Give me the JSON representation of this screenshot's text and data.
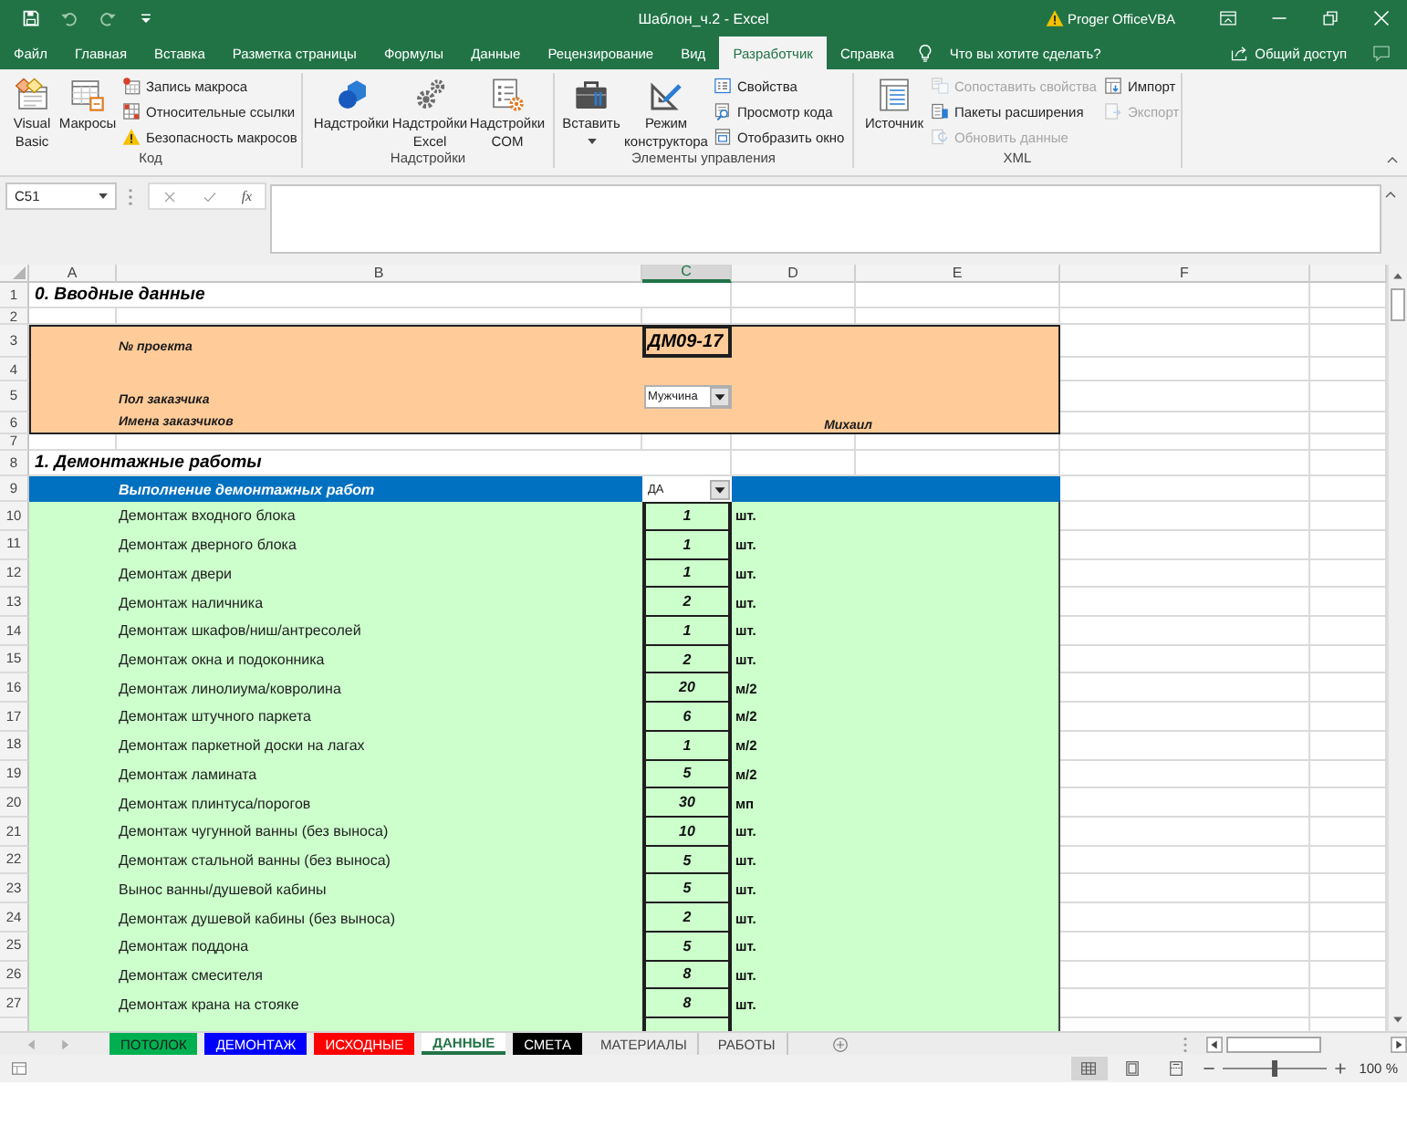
{
  "title_bar": {
    "title": "Шаблон_ч.2 - Excel",
    "account": "Proger OfficeVBA"
  },
  "ribbon_tabs": [
    {
      "label": "Файл",
      "selected": false
    },
    {
      "label": "Главная",
      "selected": false
    },
    {
      "label": "Вставка",
      "selected": false
    },
    {
      "label": "Разметка страницы",
      "selected": false
    },
    {
      "label": "Формулы",
      "selected": false
    },
    {
      "label": "Данные",
      "selected": false
    },
    {
      "label": "Рецензирование",
      "selected": false
    },
    {
      "label": "Вид",
      "selected": false
    },
    {
      "label": "Разработчик",
      "selected": true
    },
    {
      "label": "Справка",
      "selected": false
    }
  ],
  "tell_me": {
    "placeholder": "Что вы хотите сделать?"
  },
  "share": {
    "label": "Общий доступ"
  },
  "ribbon_groups": [
    {
      "label": "Код",
      "large_buttons": [
        {
          "label": "Visual Basic"
        },
        {
          "label": "Макросы"
        }
      ],
      "small_buttons": [
        {
          "label": "Запись макроса",
          "disabled": false
        },
        {
          "label": "Относительные ссылки",
          "disabled": false
        },
        {
          "label": "Безопасность макросов",
          "disabled": false
        }
      ]
    },
    {
      "label": "Надстройки",
      "large_buttons": [
        {
          "label": "Надстройки"
        },
        {
          "label": "Надстройки Excel"
        },
        {
          "label": "Надстройки COM"
        }
      ]
    },
    {
      "label": "Элементы управления",
      "large_buttons": [
        {
          "label": "Вставить"
        },
        {
          "label": "Режим конструктора"
        }
      ],
      "small_buttons": [
        {
          "label": "Свойства",
          "disabled": false
        },
        {
          "label": "Просмотр кода",
          "disabled": false
        },
        {
          "label": "Отобразить окно",
          "disabled": false
        }
      ]
    },
    {
      "label": "XML",
      "large_buttons": [
        {
          "label": "Источник"
        }
      ],
      "small_buttons": [
        {
          "label": "Сопоставить свойства",
          "disabled": true
        },
        {
          "label": "Пакеты расширения",
          "disabled": false
        },
        {
          "label": "Обновить данные",
          "disabled": true
        },
        {
          "label": "Импорт",
          "disabled": false
        },
        {
          "label": "Экспорт",
          "disabled": true
        }
      ]
    }
  ],
  "formula_bar": {
    "name_box": "C51",
    "function_button": "fx"
  },
  "columns": [
    {
      "label": "A",
      "selected": false
    },
    {
      "label": "B",
      "selected": false
    },
    {
      "label": "C",
      "selected": true
    },
    {
      "label": "D",
      "selected": false
    },
    {
      "label": "E",
      "selected": false
    },
    {
      "label": "F",
      "selected": false
    }
  ],
  "rows": [
    {
      "number": "1",
      "kind": "title",
      "text": "0. Вводные данные"
    },
    {
      "number": "2",
      "kind": "blank"
    },
    {
      "number": "3",
      "kind": "info",
      "label": "№ проекта",
      "value": "ДМ09-17"
    },
    {
      "number": "4",
      "kind": "info"
    },
    {
      "number": "5",
      "kind": "info",
      "label": "Пол заказчика",
      "dropdown": "Мужчина"
    },
    {
      "number": "6",
      "kind": "info",
      "label": "Имена заказчиков",
      "note": "Михаил"
    },
    {
      "number": "7",
      "kind": "blank"
    },
    {
      "number": "8",
      "kind": "title",
      "text": "1. Демонтажные работы"
    },
    {
      "number": "9",
      "kind": "header",
      "label": "Выполнение демонтажных работ",
      "dropdown": "ДА"
    },
    {
      "number": "10",
      "kind": "item",
      "label": "Демонтаж входного блока",
      "qty": "1",
      "unit": "шт."
    },
    {
      "number": "11",
      "kind": "item",
      "label": "Демонтаж дверного блока",
      "qty": "1",
      "unit": "шт."
    },
    {
      "number": "12",
      "kind": "item",
      "label": "Демонтаж двери",
      "qty": "1",
      "unit": "шт."
    },
    {
      "number": "13",
      "kind": "item",
      "label": "Демонтаж наличника",
      "qty": "2",
      "unit": "шт."
    },
    {
      "number": "14",
      "kind": "item",
      "label": "Демонтаж шкафов/ниш/антресолей",
      "qty": "1",
      "unit": "шт."
    },
    {
      "number": "15",
      "kind": "item",
      "label": "Демонтаж окна и подоконника",
      "qty": "2",
      "unit": "шт."
    },
    {
      "number": "16",
      "kind": "item",
      "label": "Демонтаж линолиума/ковролина",
      "qty": "20",
      "unit": "м/2"
    },
    {
      "number": "17",
      "kind": "item",
      "label": "Демонтаж штучного паркета",
      "qty": "6",
      "unit": "м/2"
    },
    {
      "number": "18",
      "kind": "item",
      "label": "Демонтаж паркетной доски на лагах",
      "qty": "1",
      "unit": "м/2"
    },
    {
      "number": "19",
      "kind": "item",
      "label": "Демонтаж ламината",
      "qty": "5",
      "unit": "м/2"
    },
    {
      "number": "20",
      "kind": "item",
      "label": "Демонтаж плинтуса/порогов",
      "qty": "30",
      "unit": "мп"
    },
    {
      "number": "21",
      "kind": "item",
      "label": "Демонтаж чугунной ванны (без выноса)",
      "qty": "10",
      "unit": "шт."
    },
    {
      "number": "22",
      "kind": "item",
      "label": "Демонтаж стальной ванны (без выноса)",
      "qty": "5",
      "unit": "шт."
    },
    {
      "number": "23",
      "kind": "item",
      "label": "Вынос ванны/душевой кабины",
      "qty": "5",
      "unit": "шт."
    },
    {
      "number": "24",
      "kind": "item",
      "label": "Демонтаж душевой кабины (без выноса)",
      "qty": "2",
      "unit": "шт."
    },
    {
      "number": "25",
      "kind": "item",
      "label": "Демонтаж поддона",
      "qty": "5",
      "unit": "шт."
    },
    {
      "number": "26",
      "kind": "item",
      "label": "Демонтаж смесителя",
      "qty": "8",
      "unit": "шт."
    },
    {
      "number": "27",
      "kind": "item",
      "label": "Демонтаж крана на стояке",
      "qty": "8",
      "unit": "шт."
    },
    {
      "kind": "partial"
    }
  ],
  "sheet_tabs": [
    {
      "label": "ПОТОЛОК",
      "color": "#00b050",
      "selected": false
    },
    {
      "label": "ДЕМОНТАЖ",
      "color": "#0000ff",
      "selected": false
    },
    {
      "label": "ИСХОДНЫЕ",
      "color": "#ff0000",
      "selected": false
    },
    {
      "label": "ДАННЫЕ",
      "selected": true
    },
    {
      "label": "СМЕТА",
      "color": "#000000",
      "selected": false
    },
    {
      "label": "МАТЕРИАЛЫ",
      "selected": false
    },
    {
      "label": "РАБОТЫ",
      "selected": false
    }
  ],
  "status_bar": {
    "views": [
      {
        "selected": true
      },
      {
        "selected": false
      },
      {
        "selected": false
      }
    ],
    "zoom": {
      "level": 0.5,
      "label": "100 %"
    }
  }
}
